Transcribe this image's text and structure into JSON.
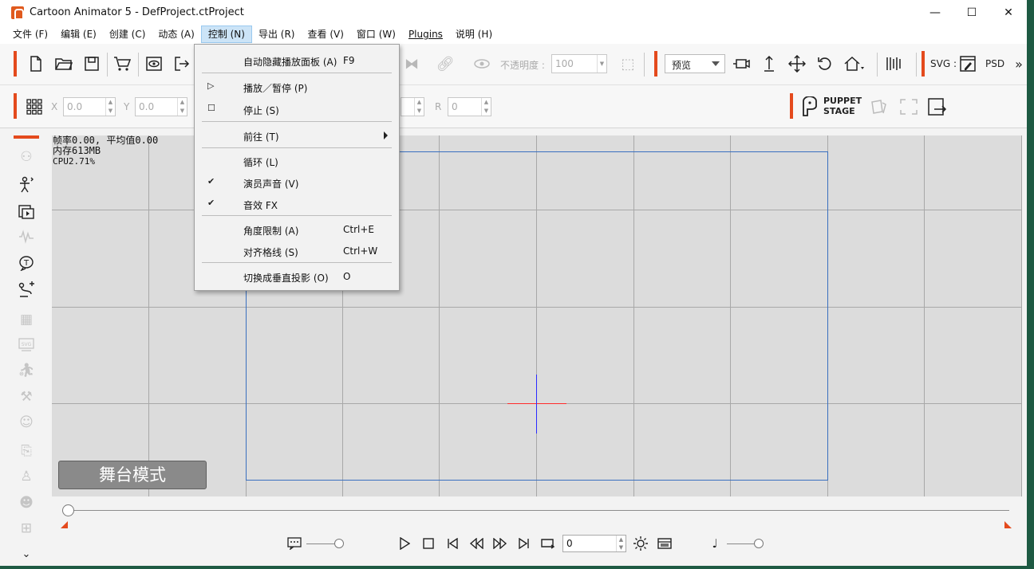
{
  "window": {
    "title": "Cartoon Animator 5 - DefProject.ctProject",
    "minimize": "—",
    "maximize": "☐",
    "close": "✕"
  },
  "menubar": [
    {
      "label": "文件 (F)"
    },
    {
      "label": "编辑 (E)"
    },
    {
      "label": "创建 (C)"
    },
    {
      "label": "动态 (A)"
    },
    {
      "label": "控制 (N)"
    },
    {
      "label": "导出 (R)"
    },
    {
      "label": "查看 (V)"
    },
    {
      "label": "窗口 (W)"
    },
    {
      "label": "Plugins"
    },
    {
      "label": "说明 (H)"
    }
  ],
  "toolbar1": {
    "opacity_label": "不透明度 :",
    "opacity_value": "100",
    "preview_select": "预览",
    "svg_label": "SVG :",
    "psd_label": "PSD"
  },
  "toolbar2": {
    "x_label": "X",
    "x_value": "0.0",
    "y_label": "Y",
    "y_value": "0.0",
    "r_label": "R",
    "r_value": "0",
    "puppet_line1": "PUPPET",
    "puppet_line2": "STAGE"
  },
  "stats": {
    "fps": "帧率0.00, 平均值0.00",
    "memory": "内存613MB",
    "cpu": "CPU2.71%"
  },
  "stage": {
    "mode_button": "舞台模式"
  },
  "timeline": {
    "frame_value": "0"
  },
  "control_menu": {
    "items": [
      {
        "label": "自动隐藏播放面板 (A)",
        "shortcut": "F9",
        "mark": ""
      },
      {
        "label": "播放／暂停 (P)",
        "shortcut": "",
        "mark": "▷"
      },
      {
        "label": "停止 (S)",
        "shortcut": "",
        "mark": "☐"
      },
      {
        "label": "前往 (T)",
        "shortcut": "",
        "mark": "",
        "submenu": true
      },
      {
        "label": "循环 (L)",
        "shortcut": "",
        "mark": ""
      },
      {
        "label": "演员声音 (V)",
        "shortcut": "",
        "mark": "✔"
      },
      {
        "label": "音效 FX",
        "shortcut": "",
        "mark": "✔"
      },
      {
        "label": "角度限制 (A)",
        "shortcut": "Ctrl+E",
        "mark": ""
      },
      {
        "label": "对齐格线 (S)",
        "shortcut": "Ctrl+W",
        "mark": ""
      },
      {
        "label": "切换成垂直投影 (O)",
        "shortcut": "O",
        "mark": ""
      }
    ]
  }
}
